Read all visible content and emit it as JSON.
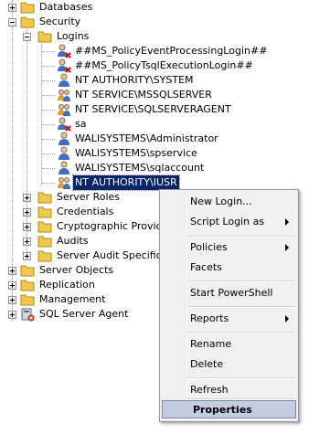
{
  "tree": {
    "databases": "Databases",
    "security": "Security",
    "logins": "Logins",
    "login_items": [
      "##MS_PolicyEventProcessingLogin##",
      "##MS_PolicyTsqlExecutionLogin##",
      "NT AUTHORITY\\SYSTEM",
      "NT SERVICE\\MSSQLSERVER",
      "NT SERVICE\\SQLSERVERAGENT",
      "sa",
      "WALISYSTEMS\\Administrator",
      "WALISYSTEMS\\spservice",
      "WALISYSTEMS\\sqlaccount",
      "NT AUTHORITY\\IUSR"
    ],
    "security_children": [
      "Server Roles",
      "Credentials",
      "Cryptographic Provider",
      "Audits",
      "Server Audit Specificat"
    ],
    "root_children": [
      "Server Objects",
      "Replication",
      "Management",
      "SQL Server Agent"
    ]
  },
  "context_menu": {
    "items": [
      "New Login...",
      "Script Login as",
      "Policies",
      "Facets",
      "Start PowerShell",
      "Reports",
      "Rename",
      "Delete",
      "Refresh",
      "Properties"
    ]
  },
  "colors": {
    "selection": "#0a246a",
    "folder": "#f2c94c",
    "menu_bg": "#f0f0f0",
    "menu_highlight": "#c3cde1"
  }
}
